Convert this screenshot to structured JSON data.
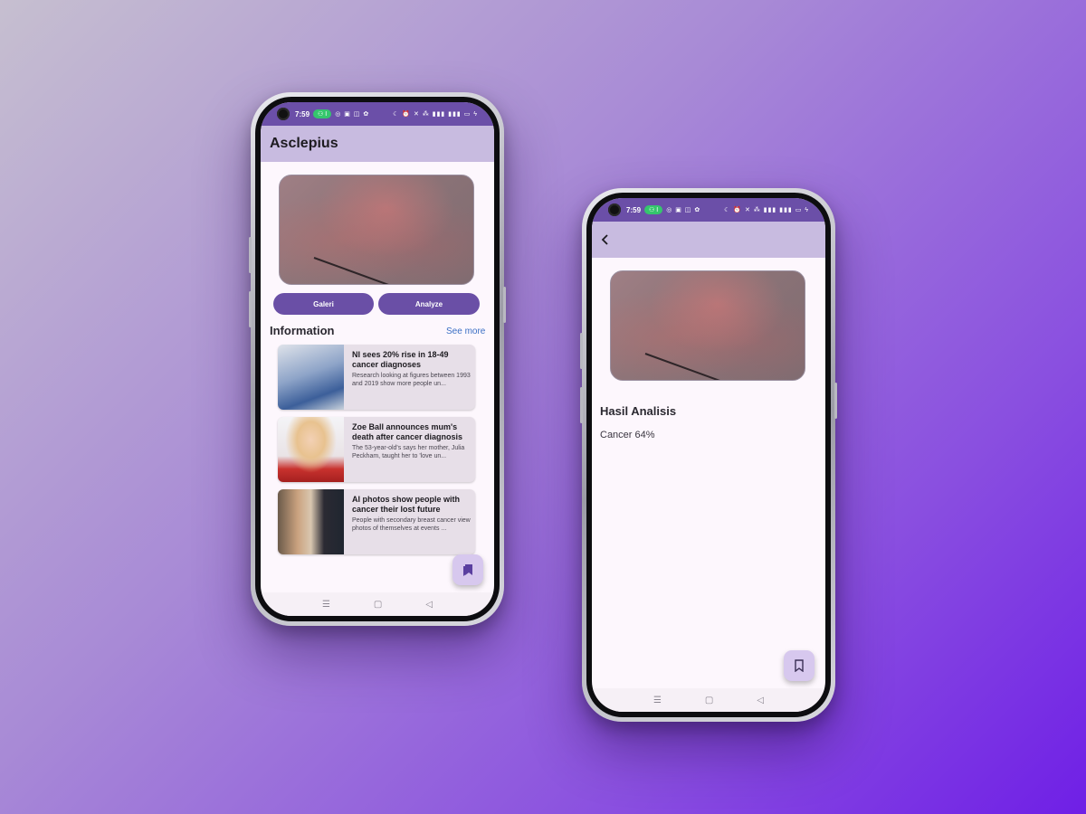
{
  "status_bar": {
    "time": "7:59",
    "pill_text": "⚇ I",
    "left_icons": "◎ ▣ ◫ ✿",
    "right_icons": "☾ ⏰ ✕ ⁂ ▮▮▮ ▮▮▮ ▭ ϟ"
  },
  "home": {
    "app_title": "Asclepius",
    "buttons": {
      "gallery": "Galeri",
      "analyze": "Analyze"
    },
    "info_section": {
      "title": "Information",
      "see_more": "See more"
    },
    "news": [
      {
        "title": "NI sees 20% rise in 18-49 cancer diagnoses",
        "desc": "Research looking at figures between 1993 and 2019 show more people un..."
      },
      {
        "title": "Zoe Ball announces mum's death after cancer diagnosis",
        "desc": "The 53-year-old's says her mother, Julia Peckham, taught her to 'love un..."
      },
      {
        "title": "AI photos show people with cancer their lost future",
        "desc": "People with secondary breast cancer view photos of themselves at events ..."
      }
    ]
  },
  "result": {
    "result_title": "Hasil Analisis",
    "result_value": "Cancer 64%"
  },
  "nav": {
    "menu": "☰",
    "home": "▢",
    "back": "◁"
  },
  "colors": {
    "statusbar": "#6b4fa8",
    "appbar": "#c8bbe0",
    "button": "#6a4fa6",
    "fab": "#d7c8ee",
    "link": "#3a6fc4"
  }
}
